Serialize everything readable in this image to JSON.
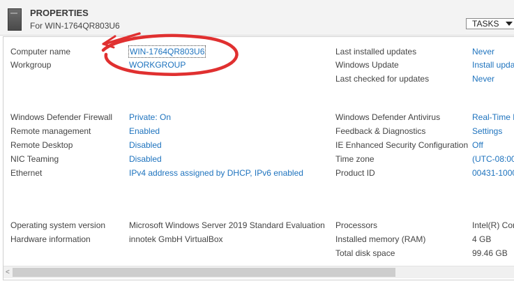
{
  "header": {
    "title": "PROPERTIES",
    "subtitle": "For WIN-1764QR803U6",
    "tasks_label": "TASKS"
  },
  "left_top": [
    {
      "label": "Computer name",
      "value": "WIN-1764QR803U6"
    },
    {
      "label": "Workgroup",
      "value": "WORKGROUP"
    }
  ],
  "right_top": [
    {
      "label": "Last installed updates",
      "value": "Never"
    },
    {
      "label": "Windows Update",
      "value": "Install upda"
    },
    {
      "label": "Last checked for updates",
      "value": "Never"
    }
  ],
  "left_mid": [
    {
      "label": "Windows Defender Firewall",
      "value": "Private: On"
    },
    {
      "label": "Remote management",
      "value": "Enabled"
    },
    {
      "label": "Remote Desktop",
      "value": "Disabled"
    },
    {
      "label": "NIC Teaming",
      "value": "Disabled"
    },
    {
      "label": "Ethernet",
      "value": "IPv4 address assigned by DHCP, IPv6 enabled"
    }
  ],
  "right_mid": [
    {
      "label": "Windows Defender Antivirus",
      "value": "Real-Time P"
    },
    {
      "label": "Feedback & Diagnostics",
      "value": "Settings"
    },
    {
      "label": "IE Enhanced Security Configuration",
      "value": "Off"
    },
    {
      "label": "Time zone",
      "value": "(UTC-08:00)"
    },
    {
      "label": "Product ID",
      "value": "00431-1000"
    }
  ],
  "left_bottom": [
    {
      "label": "Operating system version",
      "value": "Microsoft Windows Server 2019 Standard Evaluation"
    },
    {
      "label": "Hardware information",
      "value": "innotek GmbH VirtualBox"
    }
  ],
  "right_bottom": [
    {
      "label": "Processors",
      "value": "Intel(R) Cor"
    },
    {
      "label": "Installed memory (RAM)",
      "value": "4 GB"
    },
    {
      "label": "Total disk space",
      "value": "99.46 GB"
    }
  ],
  "scrollbar": {
    "left_arrow": "<"
  },
  "colors": {
    "link": "#1e73be",
    "annotation": "#e03030"
  }
}
